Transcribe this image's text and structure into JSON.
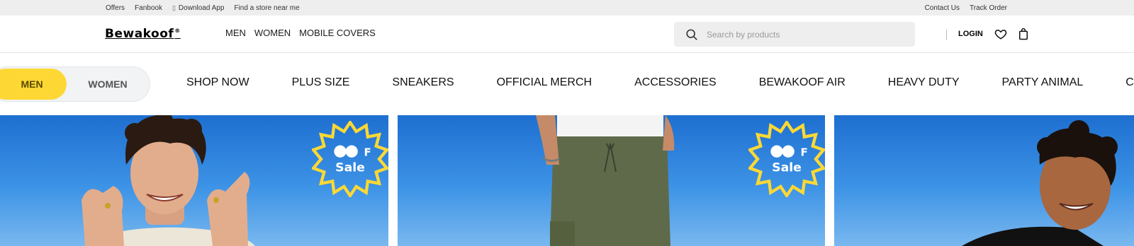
{
  "topbar": {
    "left_links": [
      "Offers",
      "Fanbook",
      "Download App",
      "Find a store near me"
    ],
    "right_links": [
      "Contact Us",
      "Track Order"
    ]
  },
  "header": {
    "logo_text": "Bewakoof",
    "logo_mark": "®",
    "nav": [
      "MEN",
      "WOMEN",
      "MOBILE COVERS"
    ],
    "search_placeholder": "Search by products",
    "login_label": "LOGIN"
  },
  "gender_toggle": {
    "options": [
      "MEN",
      "WOMEN"
    ],
    "selected": "MEN",
    "selected_color": "#fdd835"
  },
  "categories": [
    "SHOP NOW",
    "PLUS SIZE",
    "SNEAKERS",
    "OFFICIAL MERCH",
    "ACCESSORIES",
    "BEWAKOOF AIR",
    "HEAVY DUTY",
    "PARTY ANIMAL",
    "CU"
  ],
  "banners": {
    "badge_icon": "oof-sale-badge-icon",
    "badge_color": "#fdd835"
  }
}
